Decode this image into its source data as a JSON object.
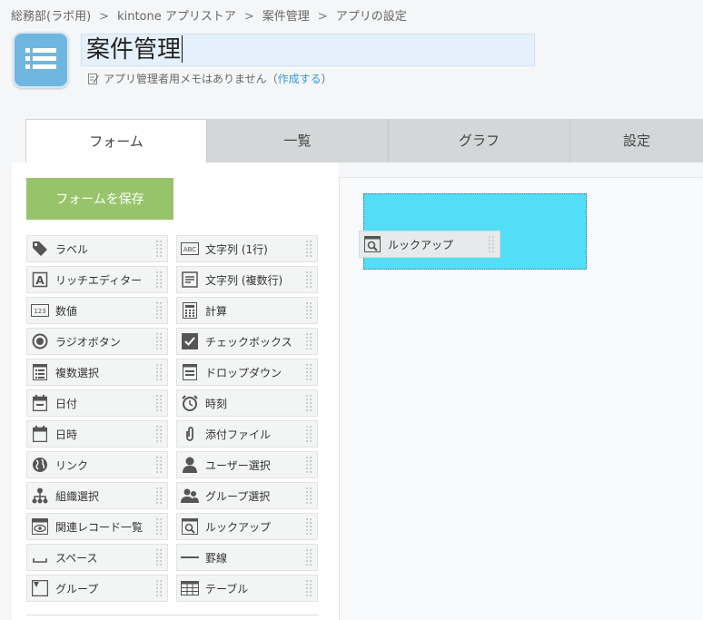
{
  "breadcrumb": {
    "items": [
      "総務部(ラボ用)",
      "kintone アプリストア",
      "案件管理",
      "アプリの設定"
    ],
    "separator": ">"
  },
  "app": {
    "title": "案件管理",
    "memo_text": "アプリ管理者用メモはありません（",
    "memo_link": "作成する",
    "memo_close": "）"
  },
  "tabs": [
    "フォーム",
    "一覧",
    "グラフ",
    "設定"
  ],
  "palette": {
    "save_label": "フォームを保存",
    "fields": [
      {
        "label": "ラベル",
        "icon": "tag-icon"
      },
      {
        "label": "文字列 (1行)",
        "icon": "abc-icon"
      },
      {
        "label": "リッチエディター",
        "icon": "rich-editor-icon"
      },
      {
        "label": "文字列 (複数行)",
        "icon": "multiline-text-icon"
      },
      {
        "label": "数値",
        "icon": "number-icon"
      },
      {
        "label": "計算",
        "icon": "calculator-icon"
      },
      {
        "label": "ラジオボタン",
        "icon": "radio-icon"
      },
      {
        "label": "チェックボックス",
        "icon": "checkbox-icon"
      },
      {
        "label": "複数選択",
        "icon": "multi-select-icon"
      },
      {
        "label": "ドロップダウン",
        "icon": "dropdown-icon"
      },
      {
        "label": "日付",
        "icon": "calendar-icon"
      },
      {
        "label": "時刻",
        "icon": "clock-icon"
      },
      {
        "label": "日時",
        "icon": "datetime-icon"
      },
      {
        "label": "添付ファイル",
        "icon": "paperclip-icon"
      },
      {
        "label": "リンク",
        "icon": "globe-icon"
      },
      {
        "label": "ユーザー選択",
        "icon": "user-icon"
      },
      {
        "label": "組織選択",
        "icon": "organization-icon"
      },
      {
        "label": "グループ選択",
        "icon": "group-icon"
      },
      {
        "label": "関連レコード一覧",
        "icon": "related-records-icon"
      },
      {
        "label": "ルックアップ",
        "icon": "lookup-icon"
      },
      {
        "label": "スペース",
        "icon": "space-icon"
      },
      {
        "label": "罫線",
        "icon": "line-icon"
      },
      {
        "label": "グループ",
        "icon": "group-field-icon"
      },
      {
        "label": "テーブル",
        "icon": "table-icon"
      }
    ]
  },
  "canvas": {
    "dragging_label": "ルックアップ",
    "dragging_icon": "lookup-icon",
    "drop_color": "#53def7"
  },
  "colors": {
    "save_button": "#97c46a",
    "link": "#3498db",
    "app_icon": "#6fb7e0"
  }
}
